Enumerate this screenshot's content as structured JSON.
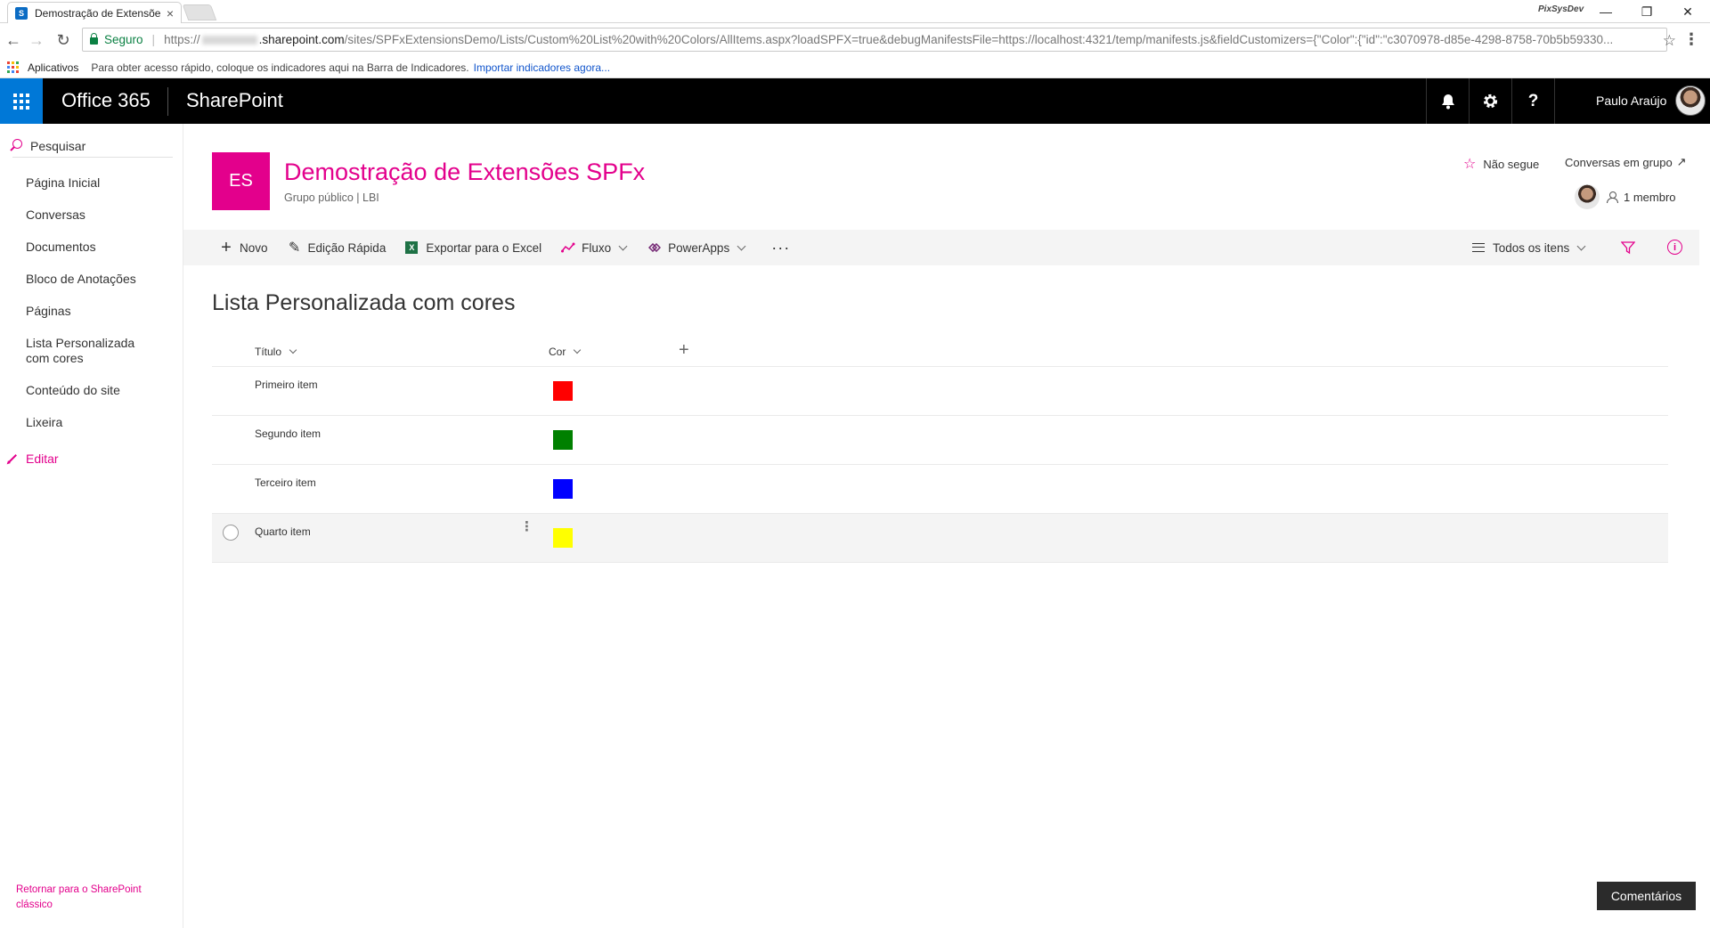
{
  "browser": {
    "tab_title": "Demostração de Extensõe",
    "tab_favicon": "S",
    "tab_close": "×",
    "window_label": "PixSysDev",
    "window_controls": {
      "minimize": "—",
      "restore": "❐",
      "close": "✕"
    },
    "secure_label": "Seguro",
    "url_prefix": "https://",
    "url_main": ".sharepoint.com",
    "url_rest": "/sites/SPFxExtensionsDemo/Lists/Custom%20List%20with%20Colors/AllItems.aspx?loadSPFX=true&debugManifestsFile=https://localhost:4321/temp/manifests.js&fieldCustomizers={\"Color\":{\"id\":\"c3070978-d85e-4298-8758-70b5b59330...",
    "bookmarks": {
      "apps_label": "Aplicativos",
      "hint": "Para obter acesso rápido, coloque os indicadores aqui na Barra de Indicadores.",
      "import_link": "Importar indicadores agora..."
    }
  },
  "suitebar": {
    "brand": "Office 365",
    "app": "SharePoint",
    "user_name": "Paulo Araújo",
    "icons": {
      "notifications": "bell-icon",
      "settings": "gear-icon",
      "help": "help-icon"
    },
    "help_glyph": "?"
  },
  "leftnav": {
    "search_label": "Pesquisar",
    "items": [
      "Página Inicial",
      "Conversas",
      "Documentos",
      "Bloco de Anotações",
      "Páginas",
      "Lista Personalizada com cores",
      "Conteúdo do site",
      "Lixeira"
    ],
    "edit_label": "Editar",
    "return_link": "Retornar para o SharePoint clássico"
  },
  "site": {
    "logo_initials": "ES",
    "title": "Demostração de Extensões SPFx",
    "subtitle": "Grupo público  |  LBI",
    "follow_label": "Não segue",
    "conversations_label": "Conversas em grupo",
    "members_label": "1 membro",
    "accent_color": "#e3008c"
  },
  "commandbar": {
    "new": "Novo",
    "quick_edit": "Edição Rápida",
    "export_excel": "Exportar para o Excel",
    "flow": "Fluxo",
    "powerapps": "PowerApps",
    "more": "···",
    "view": "Todos os itens"
  },
  "list": {
    "title": "Lista Personalizada com cores",
    "columns": {
      "title": "Título",
      "color": "Cor"
    },
    "rows": [
      {
        "title": "Primeiro item",
        "color": "#ff0000"
      },
      {
        "title": "Segundo item",
        "color": "#008000"
      },
      {
        "title": "Terceiro item",
        "color": "#0000ff"
      },
      {
        "title": "Quarto item",
        "color": "#ffff00"
      }
    ]
  },
  "feedback_label": "Comentários"
}
